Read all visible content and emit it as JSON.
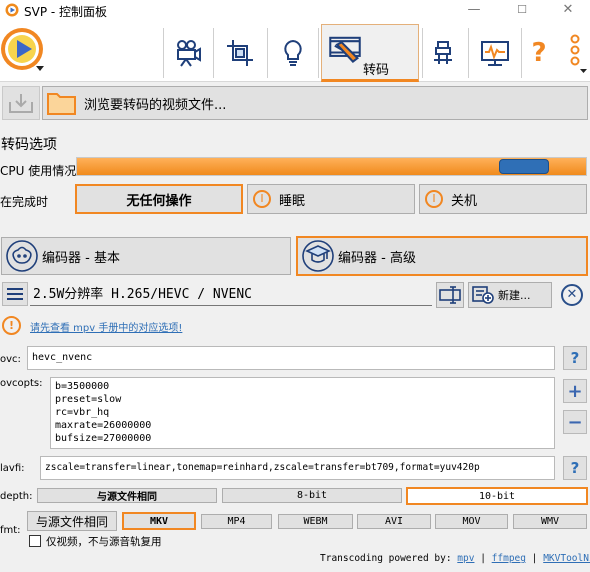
{
  "window": {
    "title": "SVP - 控制面板",
    "minimize": "—",
    "maximize": "☐",
    "close": "✕"
  },
  "toolbar": {
    "items": [
      {
        "name": "video-camera-icon"
      },
      {
        "name": "crop-icon"
      },
      {
        "name": "lightbulb-icon"
      },
      {
        "name": "transcode-icon",
        "label": "转码",
        "active": true
      },
      {
        "name": "chip-icon"
      },
      {
        "name": "monitor-icon"
      },
      {
        "name": "help-icon"
      },
      {
        "name": "more-icon"
      }
    ],
    "help_glyph": "?",
    "active_color": "#f18722"
  },
  "browse": {
    "label": "浏览要转码的视频文件..."
  },
  "section_title": "转码选项",
  "cpu": {
    "label": "CPU 使用情况",
    "level": 0.92
  },
  "on_complete": {
    "label": "在完成时",
    "options": [
      {
        "label": "无任何操作",
        "selected": true
      },
      {
        "label": "睡眠",
        "selected": false
      },
      {
        "label": "关机",
        "selected": false
      }
    ]
  },
  "encoder": {
    "basic_label": "编码器 - 基本",
    "advanced_label": "编码器 - 高级",
    "selected": "advanced"
  },
  "preset": {
    "value": "2.5W分辨率 H.265/HEVC / NVENC",
    "new_label": "新建..."
  },
  "notice": {
    "icon": "!",
    "text": "请先查看 mpv 手册中的对应选项!"
  },
  "fields": {
    "ovc_label": "ovc:",
    "ovc_value": "hevc_nvenc",
    "ovcopts_label": "ovcopts:",
    "ovcopts_lines": [
      "b=3500000",
      "preset=slow",
      "rc=vbr_hq",
      "maxrate=26000000",
      "bufsize=27000000"
    ],
    "lavfi_label": "lavfi:",
    "lavfi_value": "zscale=transfer=linear,tonemap=reinhard,zscale=transfer=bt709,format=yuv420p",
    "help_glyph": "?",
    "plus": "+",
    "minus": "−"
  },
  "depth": {
    "label": "depth:",
    "options": [
      {
        "label": "与源文件相同",
        "selected": false,
        "bold": true
      },
      {
        "label": "8-bit",
        "selected": false
      },
      {
        "label": "10-bit",
        "selected": true
      }
    ]
  },
  "fmt": {
    "label": "fmt:",
    "same_label": "与源文件相同",
    "options": [
      {
        "label": "MKV",
        "selected": true
      },
      {
        "label": "MP4",
        "selected": false
      },
      {
        "label": "WEBM",
        "selected": false
      },
      {
        "label": "AVI",
        "selected": false
      },
      {
        "label": "MOV",
        "selected": false
      },
      {
        "label": "WMV",
        "selected": false
      }
    ],
    "video_only_label": "仅视频，不与源音轨复用",
    "video_only_checked": false
  },
  "footer": {
    "prefix": "Transcoding powered by:",
    "links": [
      "mpv",
      "ffmpeg",
      "MKVToolNix"
    ],
    "sep": "|"
  }
}
